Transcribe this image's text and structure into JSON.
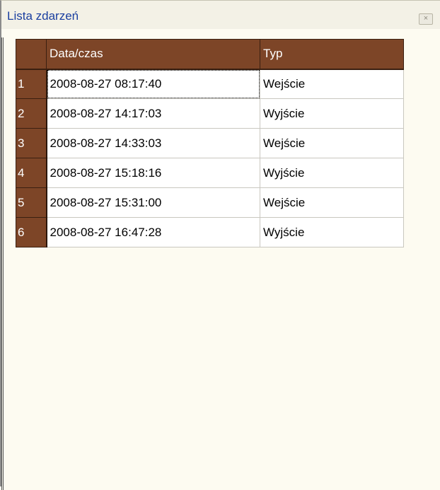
{
  "window": {
    "title": "Lista zdarzeń",
    "close_label": "×"
  },
  "grid": {
    "columns": [
      "",
      "Data/czas",
      "Typ"
    ],
    "rows": [
      {
        "num": "1",
        "datetime": "2008-08-27 08:17:40",
        "type": "Wejście"
      },
      {
        "num": "2",
        "datetime": "2008-08-27 14:17:03",
        "type": "Wyjście"
      },
      {
        "num": "3",
        "datetime": "2008-08-27 14:33:03",
        "type": "Wejście"
      },
      {
        "num": "4",
        "datetime": "2008-08-27 15:18:16",
        "type": "Wyjście"
      },
      {
        "num": "5",
        "datetime": "2008-08-27 15:31:00",
        "type": "Wejście"
      },
      {
        "num": "6",
        "datetime": "2008-08-27 16:47:28",
        "type": "Wyjście"
      }
    ]
  },
  "colors": {
    "header_bg": "#7d4527",
    "title_text": "#1a3fa0",
    "panel_bg": "#fdfbf1"
  }
}
